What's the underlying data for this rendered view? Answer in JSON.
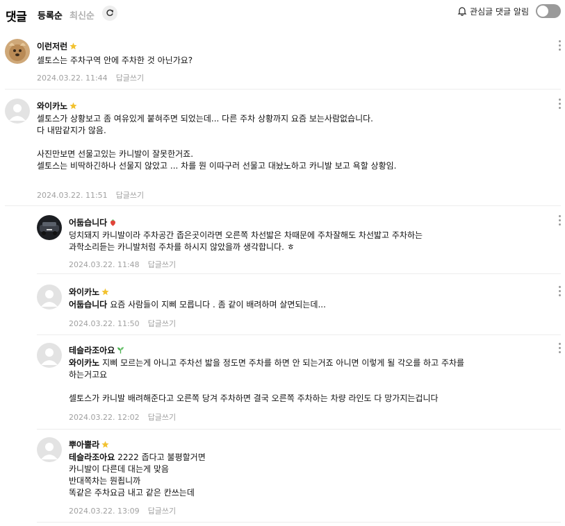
{
  "header": {
    "title": "댓글",
    "sort_registered": "등록순",
    "sort_latest": "최신순",
    "refresh_icon": "refresh-icon",
    "notify_label": "관심글 댓글 알림",
    "notify_icon": "bell-icon",
    "notify_enabled": false
  },
  "comments": [
    {
      "author": "이런저런",
      "badge": "star",
      "lines": [
        "셀토스는 주차구역 안에 주차한 것 아닌가요?"
      ],
      "date": "2024.03.22. 11:44",
      "reply": "답글쓰기"
    },
    {
      "author": "와이카노",
      "badge": "star",
      "lines": [
        "셀토스가 상황보고 좀 여유있게 붙혀주면 되었는데... 다른 주차 상황까지 요즘 보는사람없습니다.",
        "다 내맘같지가 않음.",
        "",
        "사진만보면 선물고있는 카니발이 잘못한거죠.",
        "셀토스는 비딱하긴하나 선물지 않았고 ... 차를 뭔 이따구러 선물고 대놨노하고 카니발 보고 욕할 상황임."
      ],
      "date": "2024.03.22. 11:51",
      "reply": "답글쓰기"
    },
    {
      "author": "어둡습니다",
      "badge": "strawberry",
      "lines": [
        "덩치돼지 카니발이라 주차공간 좁은곳이라면 오른쪽 차선밟은 차때문에 주차잘해도 차선밟고 주차하는",
        "과학소리듣는 카니발처럼 주차를 하시지 않았을까 생각합니다. ㅎ"
      ],
      "date": "2024.03.22. 11:48",
      "reply": "답글쓰기"
    },
    {
      "author": "와이카노",
      "badge": "star",
      "mention": "어둡습니다",
      "lines": [
        "요즘 사람들이 지삐 모릅니다 . 좀 같이 배려하며 살면되는데..."
      ],
      "date": "2024.03.22. 11:50",
      "reply": "답글쓰기"
    },
    {
      "author": "테슬라조아요",
      "badge": "sprout",
      "mention": "와이카노",
      "lines": [
        "지삐 모르는게 아니고 주차선 밟을 정도면 주차를 하면 안 되는거죠 아니면 이렇게 될 각오를 하고 주차를",
        "하는거고요",
        "",
        "셀토스가 카니발 배려해준다고 오른쪽 당겨 주차하면 결국 오른쪽 주차하는 차량 라인도 다 망가지는겁니다"
      ],
      "date": "2024.03.22. 12:02",
      "reply": "답글쓰기"
    },
    {
      "author": "뿌아뿔라",
      "badge": "star",
      "mention": "테슬라조아요",
      "lines": [
        "2222 좁다고 불평할거면",
        "카니발이 다른데 대는게 맞음",
        "반대쪽차는 뭔죕니까",
        "똑같은 주차요금 내고 같은 칸쓰는데"
      ],
      "date": "2024.03.22. 13:09",
      "reply": "답글쓰기"
    }
  ],
  "colors": {
    "star": "#f2c230",
    "strawberry": "#e0453a",
    "sprout": "#4caf50",
    "meta": "#a0a0a0",
    "toggle_off": "#9a9a9a"
  }
}
